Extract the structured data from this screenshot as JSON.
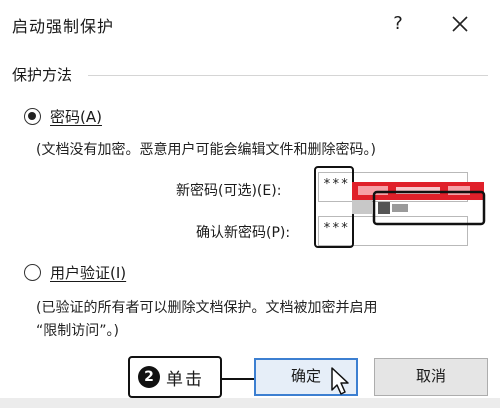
{
  "dialog": {
    "title": "启动强制保护",
    "help_glyph": "?",
    "group_label": "保护方法"
  },
  "password_option": {
    "label": "密码(A)",
    "checked": true,
    "note": "(文档没有加密。恶意用户可能会编辑文件和删除密码。)"
  },
  "fields": {
    "new_password_label": "新密码(可选)(E):",
    "new_password_value": "***",
    "confirm_password_label": "确认新密码(P):",
    "confirm_password_value": "***"
  },
  "user_auth_option": {
    "label": "用户验证(I)",
    "checked": false,
    "note_line1": "(已验证的所有者可以删除文档保护。文档被加密并启用",
    "note_line2": "“限制访问”。)"
  },
  "buttons": {
    "ok_label": "确定",
    "cancel_label": "取消"
  },
  "annotation": {
    "step_number": "2",
    "step_text": "单击"
  },
  "colors": {
    "primary_button_border": "#3c7fd1",
    "redaction_red": "#e0202a"
  }
}
